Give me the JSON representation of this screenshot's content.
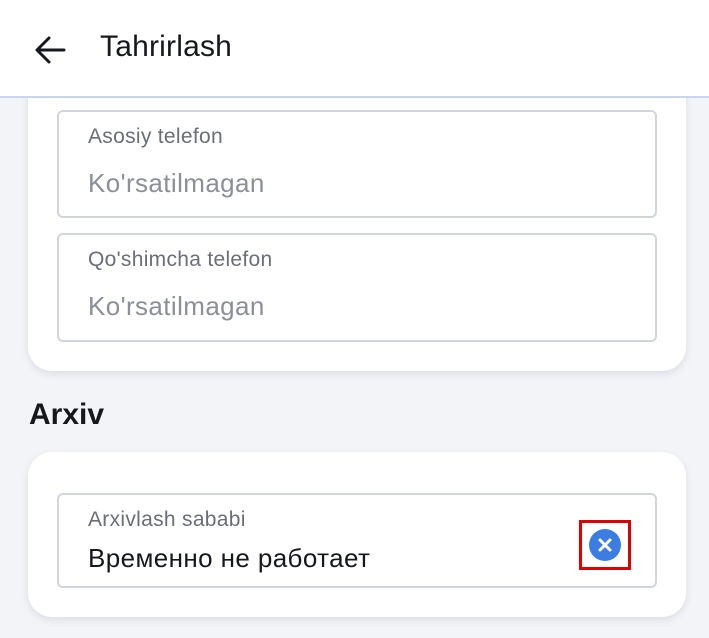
{
  "header": {
    "title": "Tahrirlash",
    "back_icon": "arrow-left-icon"
  },
  "contacts": {
    "primary_phone": {
      "label": "Asosiy telefon",
      "value": "Ko'rsatilmagan"
    },
    "secondary_phone": {
      "label": "Qo'shimcha telefon",
      "value": "Ko'rsatilmagan"
    }
  },
  "archive": {
    "section_title": "Arxiv",
    "reason": {
      "label": "Arxivlash sababi",
      "value": "Временно не работает",
      "clear_icon": "clear-circle-icon"
    }
  },
  "colors": {
    "accent": "#3b7de0",
    "highlight": "#e00000",
    "background": "#f3f4f8"
  }
}
